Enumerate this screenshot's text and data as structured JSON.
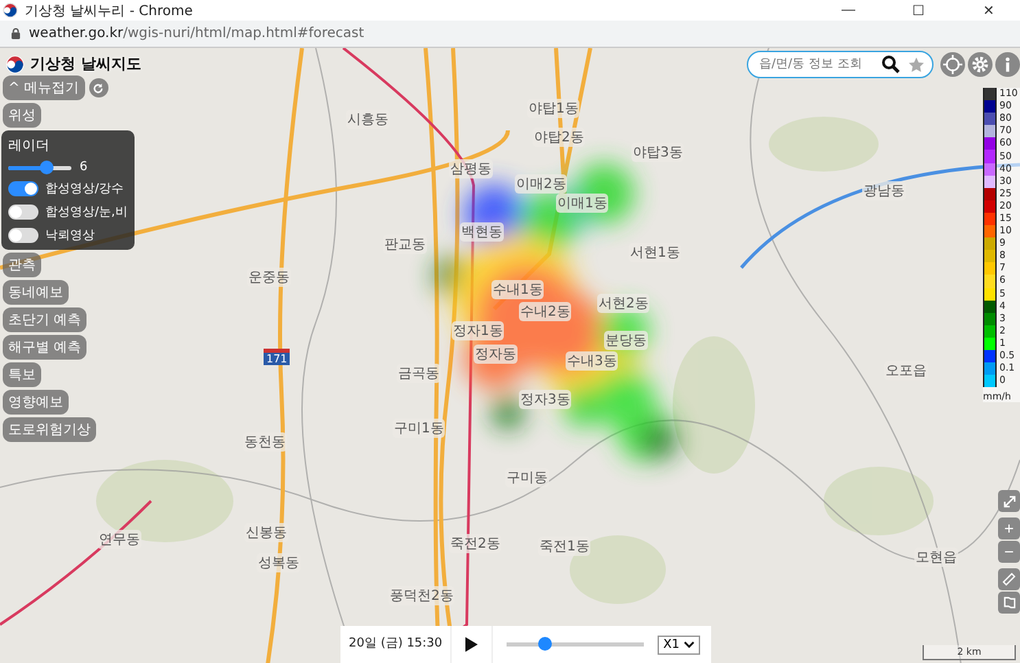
{
  "window": {
    "title": "기상청 날씨누리 - Chrome",
    "controls": [
      "—",
      "☐",
      "✕"
    ]
  },
  "address_bar": {
    "domain": "weather.go.kr",
    "path": "/wgis-nuri/html/map.html#forecast"
  },
  "logo": {
    "text": "기상청 날씨지도"
  },
  "menu_toggle": {
    "label": "메뉴접기",
    "caret": "^"
  },
  "search": {
    "placeholder": "읍/면/동 정보 조회"
  },
  "top_menu": [
    {
      "label": "위성"
    }
  ],
  "layer_panel": {
    "title": "레이더",
    "level": 0.6,
    "reading": "6",
    "toggles": [
      {
        "label": "합성영상/강수",
        "on": true
      },
      {
        "label": "합성영상/눈,비",
        "on": false
      },
      {
        "label": "낙뢰영상",
        "on": false
      }
    ]
  },
  "menu": [
    {
      "label": "관측"
    },
    {
      "label": "동네예보"
    },
    {
      "label": "초단기 예측"
    },
    {
      "label": "해구별 예측"
    },
    {
      "label": "특보"
    },
    {
      "label": "영향예보"
    },
    {
      "label": "도로위험기상"
    }
  ],
  "map_labels": [
    "시흥동",
    "야탑1동",
    "야탑2동",
    "야탑3동",
    "삼평동",
    "이매2동",
    "이매1동",
    "판교동",
    "백현동",
    "서현1동",
    "수내1동",
    "수내2동",
    "서현2동",
    "분당동",
    "정자1동",
    "정자동",
    "수내3동",
    "정자3동",
    "금곡동",
    "구미1동",
    "구미동",
    "죽전2동",
    "죽전1동",
    "풍덕천2동",
    "운중동",
    "동천동",
    "신봉동",
    "연무동",
    "성복동",
    "광남동",
    "오포읍",
    "모현읍"
  ],
  "road_shield": "171",
  "legend": {
    "unit": "mm/h",
    "items": [
      {
        "label": "110",
        "color": "#333333"
      },
      {
        "label": "90",
        "color": "#000390"
      },
      {
        "label": "80",
        "color": "#4c4eb1"
      },
      {
        "label": "70",
        "color": "#b3b4de"
      },
      {
        "label": "60",
        "color": "#9300e4"
      },
      {
        "label": "50",
        "color": "#b329ff"
      },
      {
        "label": "40",
        "color": "#c969ff"
      },
      {
        "label": "30",
        "color": "#e0b9ff"
      },
      {
        "label": "25",
        "color": "#b40000"
      },
      {
        "label": "20",
        "color": "#d20000"
      },
      {
        "label": "15",
        "color": "#ff3200"
      },
      {
        "label": "10",
        "color": "#ff6600"
      },
      {
        "label": "9",
        "color": "#ccaa00"
      },
      {
        "label": "8",
        "color": "#e0b900"
      },
      {
        "label": "7",
        "color": "#ffc800"
      },
      {
        "label": "6",
        "color": "#ffdc1f"
      },
      {
        "label": "5",
        "color": "#ffe100"
      },
      {
        "label": "4",
        "color": "#005a00"
      },
      {
        "label": "3",
        "color": "#008c00"
      },
      {
        "label": "2",
        "color": "#00be00"
      },
      {
        "label": "1",
        "color": "#00ff00"
      },
      {
        "label": "0.5",
        "color": "#0033ff"
      },
      {
        "label": "0.1",
        "color": "#009bf5"
      },
      {
        "label": "0",
        "color": "#00c8ff"
      }
    ]
  },
  "zoom_controls": [
    "+",
    "−"
  ],
  "scale": "2 km",
  "player": {
    "time": "20일 (금) 15:30",
    "level": 0.28,
    "speed": "X1"
  }
}
